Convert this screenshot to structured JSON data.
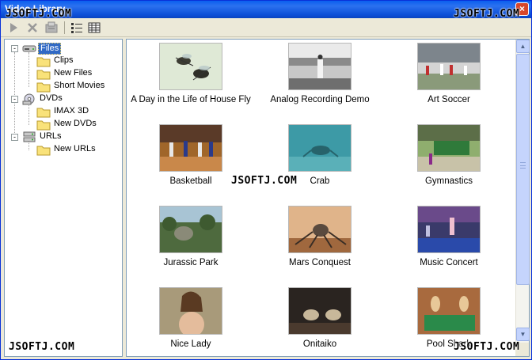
{
  "window": {
    "title": "Video Library",
    "close_glyph": "×"
  },
  "toolbar": {
    "buttons": [
      {
        "name": "play-icon"
      },
      {
        "name": "delete-icon"
      },
      {
        "name": "properties-icon"
      },
      {
        "name": "details-view-icon"
      },
      {
        "name": "thumbnails-view-icon"
      }
    ]
  },
  "tree": {
    "files": {
      "label": "Files",
      "expander": "-",
      "icon": "drive-icon"
    },
    "clips": {
      "label": "Clips",
      "icon": "folder-icon"
    },
    "new_files": {
      "label": "New Files",
      "icon": "folder-icon"
    },
    "short_movies": {
      "label": "Short Movies",
      "icon": "folder-icon"
    },
    "dvds": {
      "label": "DVDs",
      "expander": "-",
      "icon": "dvd-drive-icon"
    },
    "imax": {
      "label": "IMAX 3D",
      "icon": "folder-icon"
    },
    "new_dvds": {
      "label": "New DVDs",
      "icon": "folder-icon"
    },
    "urls": {
      "label": "URLs",
      "expander": "-",
      "icon": "network-icon"
    },
    "new_urls": {
      "label": "New URLs",
      "icon": "folder-icon"
    }
  },
  "videos": [
    {
      "title": "A Day in the Life of House Fly",
      "thumb": "flies-thumbnail"
    },
    {
      "title": "Analog Recording Demo",
      "thumb": "recording-thumbnail"
    },
    {
      "title": "Art Soccer",
      "thumb": "soccer-thumbnail"
    },
    {
      "title": "Basketball",
      "thumb": "basketball-thumbnail"
    },
    {
      "title": "Crab",
      "thumb": "crab-thumbnail"
    },
    {
      "title": "Gymnastics",
      "thumb": "gymnastics-thumbnail"
    },
    {
      "title": "Jurassic Park",
      "thumb": "dinosaur-thumbnail"
    },
    {
      "title": "Mars Conquest",
      "thumb": "mars-thumbnail"
    },
    {
      "title": "Music Concert",
      "thumb": "concert-thumbnail"
    },
    {
      "title": "Nice Lady",
      "thumb": "lady-thumbnail"
    },
    {
      "title": "Onitaiko",
      "thumb": "onitaiko-thumbnail"
    },
    {
      "title": "Pool Shark",
      "thumb": "pool-thumbnail"
    }
  ],
  "watermarks": [
    "JSOFTJ.COM",
    "JSOFTJ.COM",
    "JSOFTJ.COM",
    "JSOFTJ.COM",
    "JSOFTJ.COM"
  ],
  "scrollbar": {
    "up_glyph": "▲",
    "down_glyph": "▼"
  }
}
